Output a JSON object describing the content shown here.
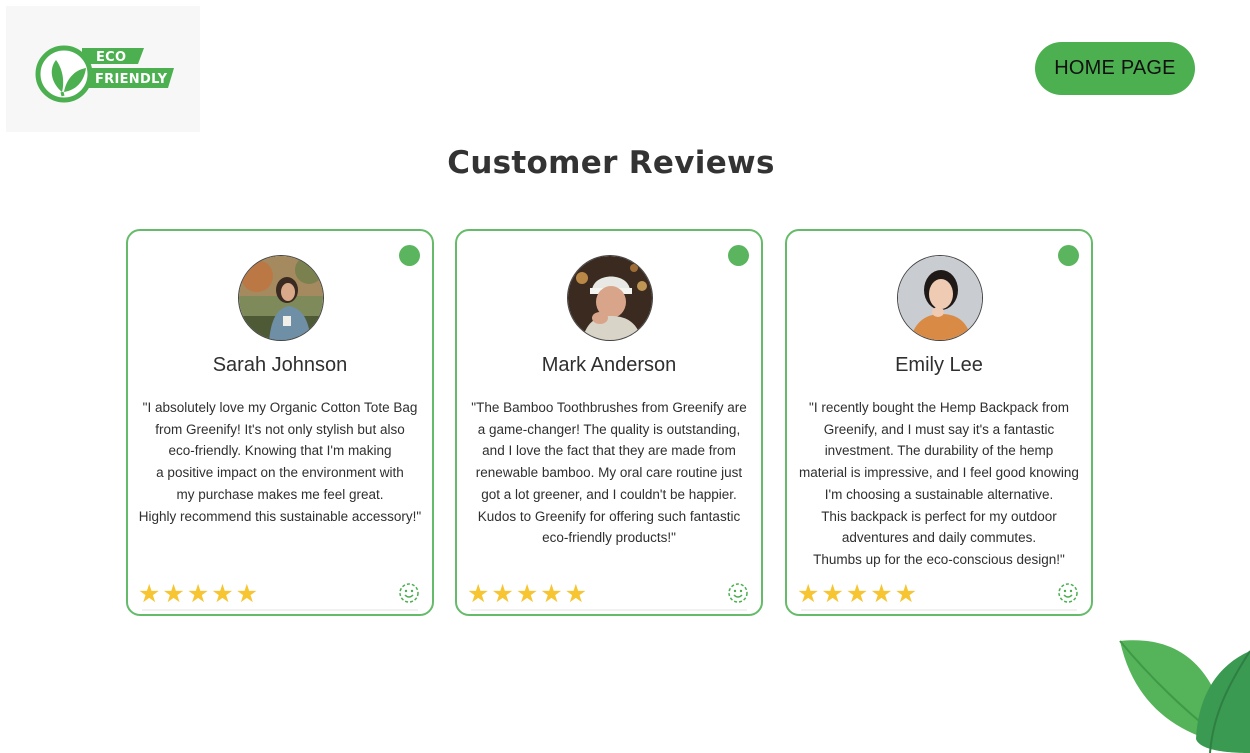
{
  "logo": {
    "line1": "ECO",
    "line2": "FRIENDLY",
    "icon": "leaf-circle-icon",
    "color": "#4caf50"
  },
  "header": {
    "home_button_label": "HOME PAGE"
  },
  "page": {
    "title": "Customer Reviews"
  },
  "colors": {
    "accent": "#4caf50",
    "star": "#f6c531",
    "text": "#2f2f2f"
  },
  "reviews": [
    {
      "name": "Sarah Johnson",
      "text": "\"I absolutely love my Organic Cotton Tote Bag\nfrom Greenify! It's not only stylish but also\neco-friendly. Knowing that I'm making\na positive impact on the environment with\nmy purchase makes me feel great.\nHighly recommend this sustainable accessory!\"",
      "stars": "★★★★★",
      "rating": 5
    },
    {
      "name": "Mark Anderson",
      "text": "\"The Bamboo Toothbrushes from Greenify are\na game-changer! The quality is outstanding,\nand I love the fact that they are made from\nrenewable bamboo. My oral care routine just\ngot a lot greener, and I couldn't be happier.\nKudos to Greenify for offering such fantastic\neco-friendly products!\"",
      "stars": "★★★★★",
      "rating": 5
    },
    {
      "name": "Emily Lee",
      "text": "\"I recently bought the Hemp Backpack from\nGreenify, and I must say it's a fantastic\ninvestment. The durability of the hemp\nmaterial is impressive, and I feel good knowing\nI'm choosing a sustainable alternative.\nThis backpack is perfect for my outdoor\nadventures and daily commutes.\nThumbs up for the eco-conscious design!\"",
      "stars": "★★★★★",
      "rating": 5
    }
  ]
}
